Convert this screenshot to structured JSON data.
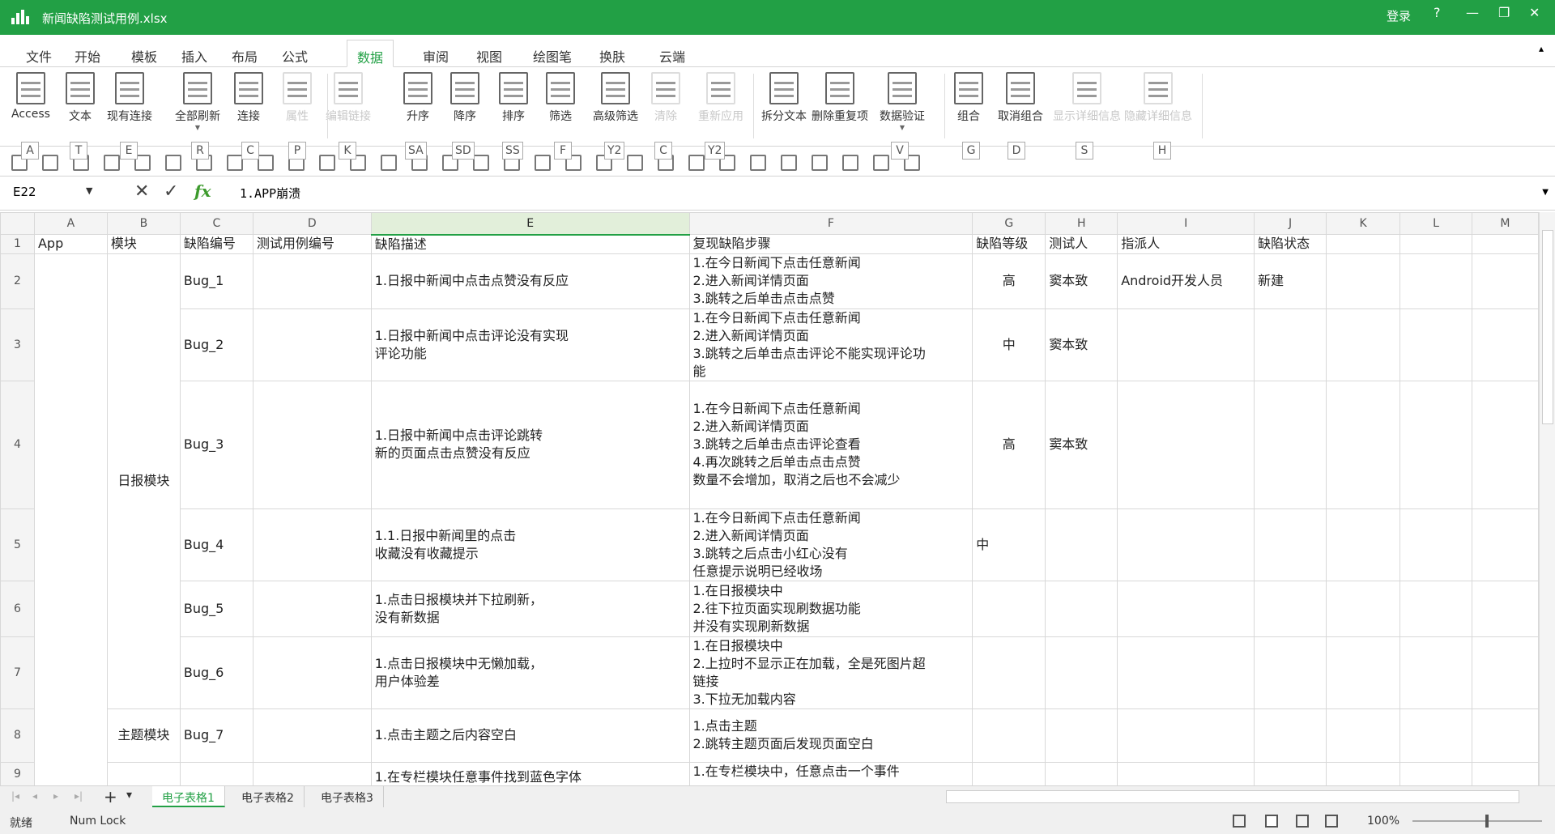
{
  "window": {
    "title": "新闻缺陷测试用例.xlsx",
    "login": "登录",
    "help": "?",
    "minimize": "—",
    "restore": "❐",
    "close": "✕"
  },
  "menu": {
    "tabs": [
      "文件",
      "开始",
      "模板",
      "插入",
      "布局",
      "公式",
      "数据",
      "审阅",
      "视图",
      "绘图笔",
      "换肤",
      "云端"
    ],
    "active": "数据",
    "collapse": "▴"
  },
  "ribbon": {
    "buttons": [
      {
        "label": "Access",
        "enabled": true
      },
      {
        "label": "文本",
        "enabled": true
      },
      {
        "label": "现有连接",
        "enabled": true
      },
      {
        "label": "全部刷新",
        "enabled": true
      },
      {
        "label": "连接",
        "enabled": true
      },
      {
        "label": "属性",
        "enabled": false
      },
      {
        "label": "编辑链接",
        "enabled": false
      },
      {
        "label": "升序",
        "enabled": true
      },
      {
        "label": "降序",
        "enabled": true
      },
      {
        "label": "排序",
        "enabled": true
      },
      {
        "label": "筛选",
        "enabled": true
      },
      {
        "label": "高级筛选",
        "enabled": true
      },
      {
        "label": "清除",
        "enabled": false
      },
      {
        "label": "重新应用",
        "enabled": false
      },
      {
        "label": "拆分文本",
        "enabled": true
      },
      {
        "label": "删除重复项",
        "enabled": true
      },
      {
        "label": "数据验证",
        "enabled": true
      },
      {
        "label": "组合",
        "enabled": true
      },
      {
        "label": "取消组合",
        "enabled": true
      },
      {
        "label": "显示详细信息",
        "enabled": false
      },
      {
        "label": "隐藏详细信息",
        "enabled": false
      }
    ]
  },
  "quick_toolbar": {
    "keytips": [
      "A",
      "T",
      "E",
      "R",
      "C",
      "P",
      "K",
      "SA",
      "SD",
      "SS",
      "F",
      "Y2",
      "C",
      "Y2",
      "V",
      "G",
      "D",
      "S",
      "H"
    ]
  },
  "formula_bar": {
    "cell_ref": "E22",
    "value": "1.APP崩溃",
    "fx": "fx"
  },
  "sheet": {
    "columns": [
      "A",
      "B",
      "C",
      "D",
      "E",
      "F",
      "G",
      "H",
      "I",
      "J",
      "K",
      "L",
      "M"
    ],
    "selected_column": "E",
    "header_row": [
      "App",
      "模块",
      "缺陷编号",
      "测试用例编号",
      "缺陷描述",
      "复现缺陷步骤",
      "缺陷等级",
      "测试人",
      "指派人",
      "缺陷状态",
      "",
      "",
      ""
    ],
    "merged": {
      "B2_B7": "日报模块",
      "B8": "主题模块"
    },
    "rows": [
      {
        "n": "2",
        "C": "Bug_1",
        "E": "1.日报中新闻中点击点赞没有反应",
        "F": "1.在今日新闻下点击任意新闻\n2.进入新闻详情页面\n3.跳转之后单击点击点赞",
        "G": "高",
        "H": "窦本致",
        "I": "Android开发人员",
        "J": "新建"
      },
      {
        "n": "3",
        "C": "Bug_2",
        "E": "1.日报中新闻中点击评论没有实现\n评论功能",
        "F": "1.在今日新闻下点击任意新闻\n2.进入新闻详情页面\n3.跳转之后单击点击评论不能实现评论功\n能",
        "G": "中",
        "H": "窦本致",
        "I": "",
        "J": ""
      },
      {
        "n": "4",
        "C": "Bug_3",
        "E": "1.日报中新闻中点击评论跳转\n新的页面点击点赞没有反应",
        "F": "1.在今日新闻下点击任意新闻\n2.进入新闻详情页面\n3.跳转之后单击点击评论查看\n4.再次跳转之后单击点击点赞\n数量不会增加，取消之后也不会减少",
        "G": "高",
        "H": "窦本致",
        "I": "",
        "J": ""
      },
      {
        "n": "5",
        "C": "Bug_4",
        "E": "1.1.日报中新闻里的点击\n收藏没有收藏提示",
        "F": "1.在今日新闻下点击任意新闻\n2.进入新闻详情页面\n3.跳转之后点击小红心没有\n任意提示说明已经收场",
        "G": "中",
        "H": "",
        "I": "",
        "J": ""
      },
      {
        "n": "6",
        "C": "Bug_5",
        "E": "1.点击日报模块并下拉刷新，\n没有新数据",
        "F": "1.在日报模块中\n2.往下拉页面实现刷数据功能\n并没有实现刷新数据",
        "G": "",
        "H": "",
        "I": "",
        "J": ""
      },
      {
        "n": "7",
        "C": "Bug_6",
        "E": "1.点击日报模块中无懒加载，\n用户体验差",
        "F": "1.在日报模块中\n2.上拉时不显示正在加载，全是死图片超\n链接\n3.下拉无加载内容",
        "G": "",
        "H": "",
        "I": "",
        "J": ""
      },
      {
        "n": "8",
        "C": "Bug_7",
        "E": "1.点击主题之后内容空白",
        "F": "1.点击主题\n2.跳转主题页面后发现页面空白",
        "G": "",
        "H": "",
        "I": "",
        "J": ""
      },
      {
        "n": "9",
        "C": "",
        "E": "1.在专栏模块任意事件找到蓝色字体",
        "F": "1.在专栏模块中，任意点击一个事件",
        "G": "",
        "H": "",
        "I": "",
        "J": ""
      }
    ]
  },
  "sheet_tabs": {
    "tabs": [
      "电子表格1",
      "电子表格2",
      "电子表格3"
    ],
    "active": "电子表格1",
    "add": "+",
    "list": "▾"
  },
  "status": {
    "ready": "就绪",
    "num_lock": "Num Lock",
    "zoom": "100%"
  },
  "colors": {
    "accent": "#22a045"
  }
}
